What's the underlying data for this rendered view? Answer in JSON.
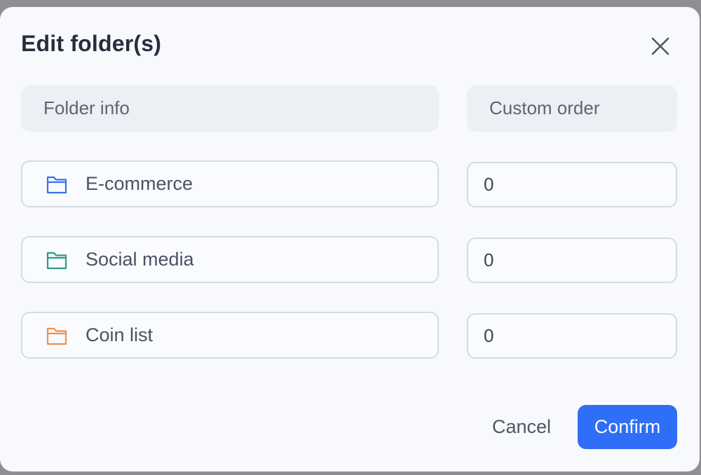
{
  "dialog": {
    "title": "Edit folder(s)",
    "close_icon": "close-icon"
  },
  "headers": {
    "folder_info": "Folder info",
    "custom_order": "Custom order"
  },
  "folders": [
    {
      "name": "E-commerce",
      "order": "0",
      "icon": "folder-icon",
      "color": "#3b6ff0"
    },
    {
      "name": "Social media",
      "order": "0",
      "icon": "folder-icon",
      "color": "#2a9d86"
    },
    {
      "name": "Coin list",
      "order": "0",
      "icon": "folder-icon",
      "color": "#f0904d"
    }
  ],
  "actions": {
    "cancel_label": "Cancel",
    "confirm_label": "Confirm"
  },
  "colors": {
    "accent": "#2f6ef6"
  }
}
